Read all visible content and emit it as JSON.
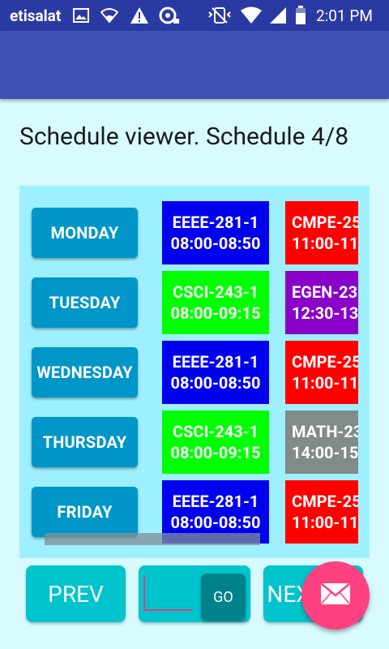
{
  "status_bar": {
    "carrier": "etisalat",
    "time": "2:01 PM",
    "icons": [
      "image-icon",
      "wifi-icon",
      "warning-icon",
      "data-saver-icon",
      "vibrate-icon",
      "wifi-signal-icon",
      "cell-signal-icon",
      "battery-icon"
    ]
  },
  "title": "Schedule viewer. Schedule 4/8",
  "schedule": [
    {
      "day": "MONDAY",
      "classes": [
        {
          "course": "EEEE-281-1",
          "time": "08:00-08:50",
          "color": "#0000ee"
        },
        {
          "course": "CMPE-25",
          "time": "11:00-11",
          "color": "#ff0000"
        }
      ]
    },
    {
      "day": "TUESDAY",
      "classes": [
        {
          "course": "CSCI-243-1",
          "time": "08:00-09:15",
          "color": "#00ff00"
        },
        {
          "course": "EGEN-23",
          "time": "12:30-13",
          "color": "#8b00c8"
        }
      ]
    },
    {
      "day": "WEDNESDAY",
      "classes": [
        {
          "course": "EEEE-281-1",
          "time": "08:00-08:50",
          "color": "#0000ee"
        },
        {
          "course": "CMPE-25",
          "time": "11:00-11",
          "color": "#ff0000"
        }
      ]
    },
    {
      "day": "THURSDAY",
      "classes": [
        {
          "course": "CSCI-243-1",
          "time": "08:00-09:15",
          "color": "#00ff00"
        },
        {
          "course": "MATH-23",
          "time": "14:00-15",
          "color": "#808b8a"
        }
      ]
    },
    {
      "day": "FRIDAY",
      "classes": [
        {
          "course": "EEEE-281-1",
          "time": "08:00-08:50",
          "color": "#0000ee"
        },
        {
          "course": "CMPE-25",
          "time": "11:00-11",
          "color": "#ff0000"
        }
      ]
    }
  ],
  "buttons": {
    "prev": "PREV",
    "go": "GO",
    "next": "NEXT"
  },
  "goto_input": {
    "value": ""
  },
  "fab_icon": "email-icon"
}
